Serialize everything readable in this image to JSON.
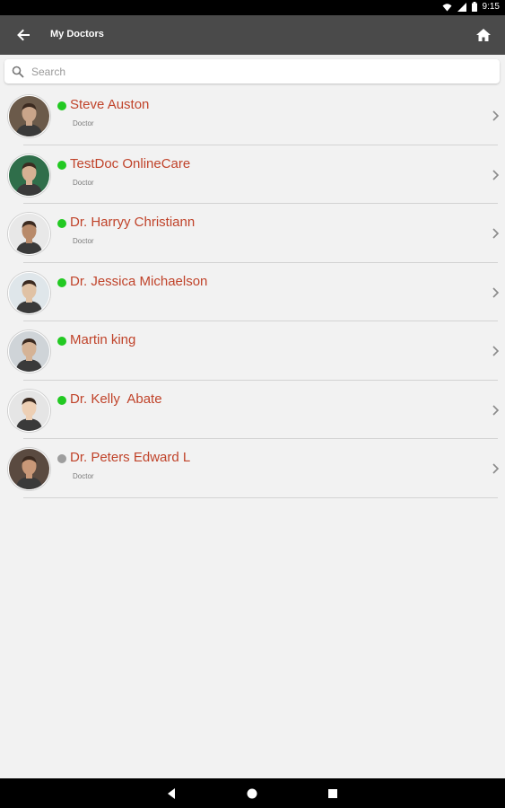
{
  "status": {
    "time": "9:15"
  },
  "appbar": {
    "title": "My Doctors"
  },
  "search": {
    "placeholder": "Search"
  },
  "doctors": [
    {
      "name": "Steve Auston",
      "role": "Doctor",
      "online": true,
      "avatar_bg": "#6b5a4a",
      "skin": "#c9a58a"
    },
    {
      "name": "TestDoc OnlineCare",
      "role": "Doctor",
      "online": true,
      "avatar_bg": "#2f6e4a",
      "skin": "#d6b193"
    },
    {
      "name": "Dr. Harryy Christiann",
      "role": "Doctor",
      "online": true,
      "avatar_bg": "#e8e8e8",
      "skin": "#b88a6a"
    },
    {
      "name": "Dr. Jessica Michaelson",
      "role": "",
      "online": true,
      "avatar_bg": "#dfe6ea",
      "skin": "#e0c2a5"
    },
    {
      "name": "Martin king",
      "role": "",
      "online": true,
      "avatar_bg": "#cfd4d8",
      "skin": "#d5b396"
    },
    {
      "name": "Dr. Kelly  Abate",
      "role": "",
      "online": true,
      "avatar_bg": "#e5e5e5",
      "skin": "#edcfb4"
    },
    {
      "name": "Dr. Peters Edward L",
      "role": "Doctor",
      "online": false,
      "avatar_bg": "#5a4a40",
      "skin": "#c99878"
    }
  ],
  "colors": {
    "online": "#22c922",
    "offline": "#9e9e9e",
    "name": "#c0432a",
    "appbar": "#4a4a4a"
  }
}
